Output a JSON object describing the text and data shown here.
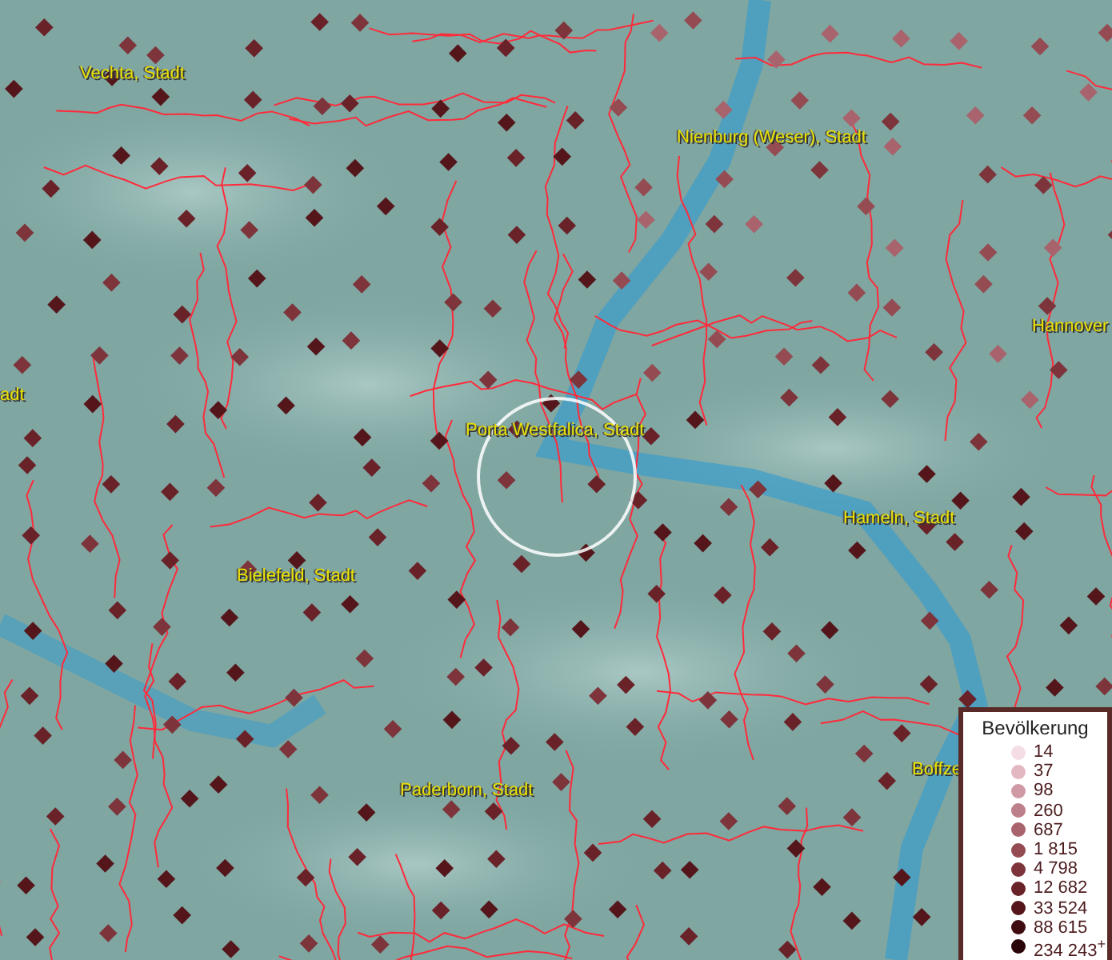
{
  "map": {
    "labels": [
      {
        "text": "Vechta, Stadt"
      },
      {
        "text": "Nienburg (Weser), Stadt"
      },
      {
        "text": "Hannover"
      },
      {
        "text": "adt"
      },
      {
        "text": "Porta Westfalica, Stadt"
      },
      {
        "text": "Hameln, Stadt"
      },
      {
        "text": "Bielefeld, Stadt"
      },
      {
        "text": "Paderborn, Stadt"
      },
      {
        "text": "Boffze"
      }
    ]
  },
  "legend": {
    "title": "Bevölkerung",
    "classes": [
      {
        "value": "14",
        "color": "#f5dde6"
      },
      {
        "value": "37",
        "color": "#e3b8c3"
      },
      {
        "value": "98",
        "color": "#d09aa5"
      },
      {
        "value": "260",
        "color": "#bd7f89"
      },
      {
        "value": "687",
        "color": "#a8636c"
      },
      {
        "value": "1 815",
        "color": "#944c52"
      },
      {
        "value": "4 798",
        "color": "#7d343b"
      },
      {
        "value": "12 682",
        "color": "#6a2229"
      },
      {
        "value": "33 524",
        "color": "#55161b"
      },
      {
        "value": "88 615",
        "color": "#3e0c10"
      },
      {
        "value": "234 243$^{+}$",
        "color": "#2a0508"
      }
    ]
  }
}
